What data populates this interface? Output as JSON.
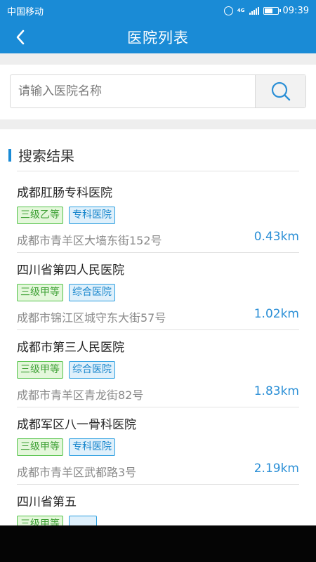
{
  "status_bar": {
    "carrier": "中国移动",
    "network": "4G",
    "time": "09:39",
    "battery_level": 0.7
  },
  "header": {
    "title": "医院列表",
    "back_icon": "chevron-left-icon"
  },
  "search": {
    "placeholder": "请输入医院名称",
    "value": "",
    "button_icon": "search-icon"
  },
  "results": {
    "section_title": "搜索结果",
    "hospitals": [
      {
        "name": "成都肛肠专科医院",
        "level": "三级乙等",
        "type": "专科医院",
        "address": "成都市青羊区大墙东街152号",
        "distance": "0.43km"
      },
      {
        "name": "四川省第四人民医院",
        "level": "三级甲等",
        "type": "综合医院",
        "address": "成都市锦江区城守东大街57号",
        "distance": "1.02km"
      },
      {
        "name": "成都市第三人民医院",
        "level": "三级甲等",
        "type": "综合医院",
        "address": "成都市青羊区青龙街82号",
        "distance": "1.83km"
      },
      {
        "name": "成都军区八一骨科医院",
        "level": "三级甲等",
        "type": "专科医院",
        "address": "成都市青羊区武都路3号",
        "distance": "2.19km"
      },
      {
        "name": "四川省第五",
        "level": "三级甲等",
        "type": "",
        "address": "",
        "distance": ""
      }
    ]
  },
  "colors": {
    "primary": "#1a8bd6",
    "tag_green": "#3ea035",
    "tag_blue": "#1886cc",
    "distance": "#2b8fd6"
  }
}
